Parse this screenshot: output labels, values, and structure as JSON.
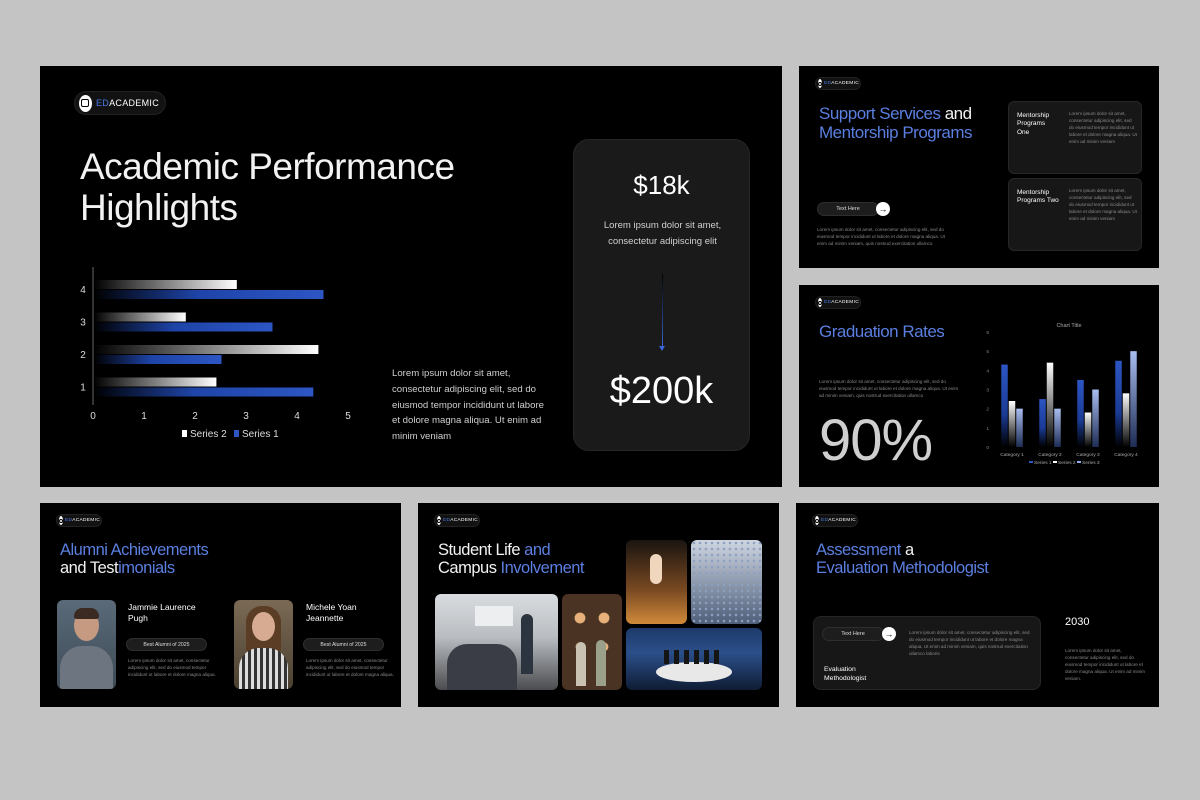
{
  "brand": {
    "prefix": "ED",
    "suffix": "ACADEMIC"
  },
  "slide1": {
    "title_line1": "Academic Performance",
    "title_line2": "Highlights",
    "paragraph": "Lorem ipsum dolor sit amet, consectetur adipiscing elit, sed do eiusmod tempor incididunt ut labore et dolore magna aliqua. Ut enim ad minim veniam",
    "stat_top": "$18k",
    "stat_desc": "Lorem ipsum dolor sit amet, consectetur adipiscing elit",
    "stat_bottom": "$200k"
  },
  "chart_data": [
    {
      "type": "bar",
      "orientation": "horizontal",
      "categories": [
        "1",
        "2",
        "3",
        "4"
      ],
      "series": [
        {
          "name": "Series 1",
          "values": [
            4.3,
            2.5,
            3.5,
            4.5
          ]
        },
        {
          "name": "Series 2",
          "values": [
            2.4,
            4.4,
            1.8,
            2.8
          ]
        }
      ],
      "xlim": [
        0,
        5
      ],
      "x_ticks": [
        "0",
        "1",
        "2",
        "3",
        "4",
        "5"
      ],
      "legend": "bottom",
      "colors": {
        "Series 1": "#2d56c4",
        "Series 2": "#ffffff"
      }
    },
    {
      "type": "bar",
      "title": "Chart Title",
      "categories": [
        "Category 1",
        "Category 2",
        "Category 3",
        "Category 4"
      ],
      "series": [
        {
          "name": "Series 1",
          "values": [
            4.3,
            2.5,
            3.5,
            4.5
          ]
        },
        {
          "name": "Series 2",
          "values": [
            2.4,
            4.4,
            1.8,
            2.8
          ]
        },
        {
          "name": "Series 3",
          "values": [
            2.0,
            2.0,
            3.0,
            5.0
          ]
        }
      ],
      "ylim": [
        0,
        6
      ],
      "y_ticks": [
        "0",
        "1",
        "2",
        "3",
        "4",
        "5",
        "6"
      ],
      "legend": "bottom",
      "colors": {
        "Series 1": "#2d56c4",
        "Series 2": "#ffffff",
        "Series 3": "#8fa8e8"
      }
    }
  ],
  "slide2": {
    "title_w1": "Support Services",
    "title_b1": "and",
    "title_line2": "Mentorship Programs",
    "button_label": "Text Here",
    "paragraph": "Lorem ipsum dolor sit amet, consectetur adipiscing elit, sed do eiusmod tempor incididunt ut labore et dolore magna aliqua. Ut enim ad minim veniam, quis nostrud exercitation ullamco",
    "cards": [
      {
        "label": "Mentorship Programs One",
        "text": "Lorem ipsum dolor sit amet, consectetur adipiscing elit, sed do eiusmod tempor incididunt ut labore et dolore magna aliqua. Ut enim ad minim veniam"
      },
      {
        "label": "Mentorship Programs Two",
        "text": "Lorem ipsum dolor sit amet, consectetur adipiscing elit, sed do eiusmod tempor incididunt ut labore et dolore magna aliqua. Ut enim ad minim veniam"
      }
    ]
  },
  "slide3": {
    "title_w": "Graduation",
    "title_b": "Rates",
    "paragraph": "Lorem ipsum dolor sit amet, consectetur adipiscing elit, sed do eiusmod tempor incididunt ut labore et dolore magna aliqua. Ut enim ad minim veniam, quis nostrud exercitation ullamco",
    "big_stat": "90%"
  },
  "slide4": {
    "title_w1": "Alumni Achievements",
    "title_w2": "and Test",
    "title_b2": "imonials",
    "people": [
      {
        "name": "Jammie Laurence Pugh",
        "badge": "Best Alumni of 2025",
        "text": "Lorem ipsum dolor sit amet, consectetur adipiscing elit, sed do eiusmod tempor incididunt ut labore et dolore magna aliqua."
      },
      {
        "name": "Michele Yoan Jeannette",
        "badge": "Best Alumni of 2025",
        "text": "Lorem ipsum dolor sit amet, consectetur adipiscing elit, sed do eiusmod tempor incididunt ut labore et dolore magna aliqua."
      }
    ]
  },
  "slide5": {
    "title_w1": "Student Life",
    "title_b1": "and",
    "title_w2": "Campus",
    "title_b2": "Involvement"
  },
  "slide6": {
    "title_w1": "Assessment",
    "title_b1": "a",
    "title_line2": "Evaluation Methodologist",
    "button_label": "Text Here",
    "card_label": "Evaluation Methodologist",
    "card_text": "Lorem ipsum dolor sit amet, consectetur adipiscing elit, sed do eiusmod tempor incididunt ut labore et dolore magna aliqua. Ut enim ad minim veniam, quis nostrud exercitation ullamco laboris",
    "year": "2030",
    "side_text": "Lorem ipsum dolor sit amet, consectetur adipiscing elit, sed do eiusmod tempor incididunt ut labore et dolore magna aliqua. Ut enim ad minim veniam."
  }
}
